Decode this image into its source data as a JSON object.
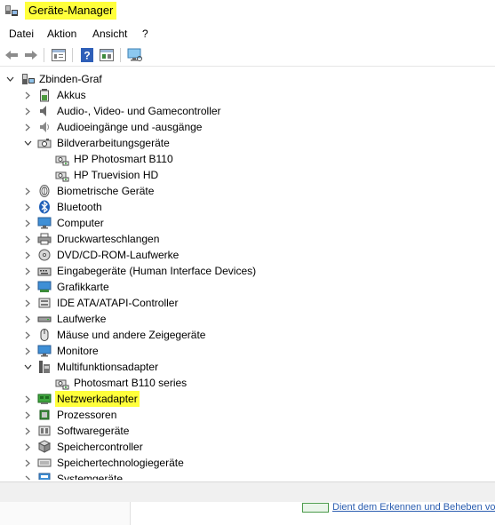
{
  "window": {
    "title": "Geräte-Manager"
  },
  "menu": [
    "Datei",
    "Aktion",
    "Ansicht",
    "?"
  ],
  "toolbar": [
    "back-arrow-icon",
    "forward-arrow-icon",
    "properties-icon",
    "help-icon",
    "update-driver-icon",
    "monitor-scan-icon"
  ],
  "tree": {
    "root": "Zbinden-Graf",
    "items": [
      {
        "label": "Akkus",
        "expanded": false
      },
      {
        "label": "Audio-, Video- und Gamecontroller",
        "expanded": false
      },
      {
        "label": "Audioeingänge und -ausgänge",
        "expanded": false
      },
      {
        "label": "Bildverarbeitungsgeräte",
        "expanded": true,
        "children": [
          "HP Photosmart B110",
          "HP Truevision HD"
        ]
      },
      {
        "label": "Biometrische Geräte",
        "expanded": false
      },
      {
        "label": "Bluetooth",
        "expanded": false
      },
      {
        "label": "Computer",
        "expanded": false
      },
      {
        "label": "Druckwarteschlangen",
        "expanded": false
      },
      {
        "label": "DVD/CD-ROM-Laufwerke",
        "expanded": false
      },
      {
        "label": "Eingabegeräte (Human Interface Devices)",
        "expanded": false
      },
      {
        "label": "Grafikkarte",
        "expanded": false
      },
      {
        "label": "IDE ATA/ATAPI-Controller",
        "expanded": false
      },
      {
        "label": "Laufwerke",
        "expanded": false
      },
      {
        "label": "Mäuse und andere Zeigegeräte",
        "expanded": false
      },
      {
        "label": "Monitore",
        "expanded": false
      },
      {
        "label": "Multifunktionsadapter",
        "expanded": true,
        "children": [
          "Photosmart B110 series"
        ]
      },
      {
        "label": "Netzwerkadapter",
        "expanded": false,
        "highlighted": true
      },
      {
        "label": "Prozessoren",
        "expanded": false
      },
      {
        "label": "Softwaregeräte",
        "expanded": false
      },
      {
        "label": "Speichercontroller",
        "expanded": false
      },
      {
        "label": "Speichertechnologiegeräte",
        "expanded": false
      },
      {
        "label": "Systemgeräte",
        "expanded": false
      }
    ]
  },
  "bottom_link": "Dient dem Erkennen und Beheben von",
  "colors": {
    "highlight": "#ffff3b",
    "window_bg": "#ffffff",
    "status_bg": "#f0f0f0"
  }
}
